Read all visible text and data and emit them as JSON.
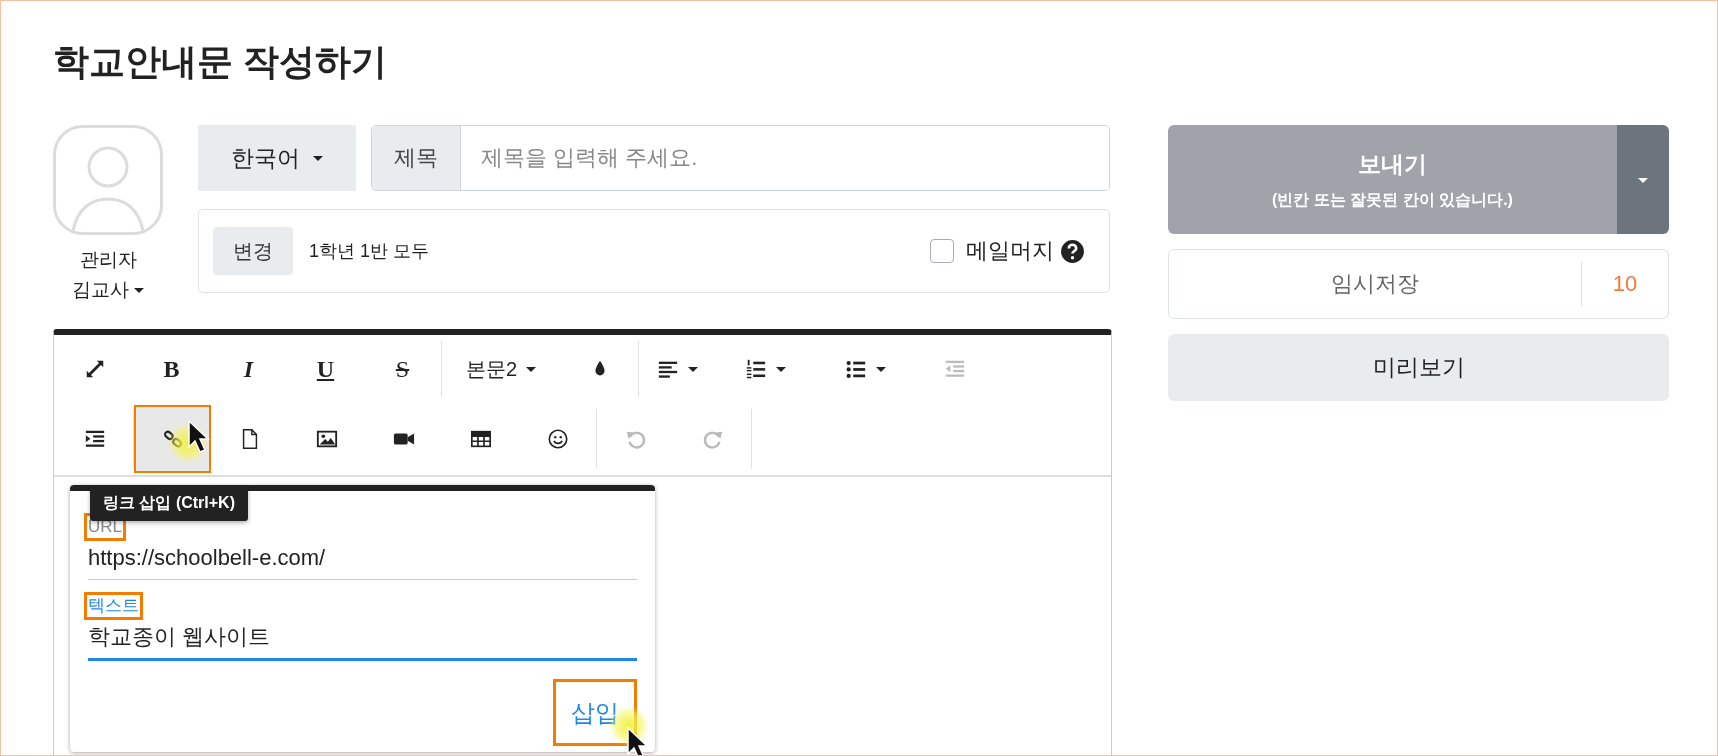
{
  "page_title": "학교안내문 작성하기",
  "author": {
    "role": "관리자",
    "name": "김교사"
  },
  "language": "한국어",
  "subject": {
    "label": "제목",
    "placeholder": "제목을 입력해 주세요."
  },
  "recipients": {
    "button": "변경",
    "value": "1학년 1반 모두",
    "mail_merge": {
      "label": "메일머지",
      "checked": false
    }
  },
  "toolbar": {
    "rows": [
      [
        {
          "kind": "expand",
          "disabled": false,
          "selected": false,
          "annotated": false
        },
        {
          "kind": "bold",
          "label": "B",
          "disabled": false,
          "selected": false,
          "annotated": false
        },
        {
          "kind": "italic",
          "label": "I",
          "disabled": false,
          "selected": false,
          "annotated": false
        },
        {
          "kind": "underline",
          "label": "U",
          "disabled": false,
          "selected": false,
          "annotated": false
        },
        {
          "kind": "strike",
          "label": "S",
          "disabled": false,
          "selected": false,
          "annotated": false
        },
        {
          "kind": "divider"
        },
        {
          "kind": "style-dropdown",
          "label": "본문2",
          "disabled": false,
          "selected": false,
          "annotated": false
        },
        {
          "kind": "color",
          "disabled": false,
          "selected": false,
          "annotated": false
        },
        {
          "kind": "divider"
        },
        {
          "kind": "align",
          "disabled": false,
          "selected": false,
          "annotated": false
        },
        {
          "kind": "ordered-list",
          "disabled": false,
          "selected": false,
          "annotated": false
        },
        {
          "kind": "bullet-list",
          "disabled": false,
          "selected": false,
          "annotated": false
        },
        {
          "kind": "outdent",
          "disabled": true,
          "selected": false,
          "annotated": false
        }
      ],
      [
        {
          "kind": "indent",
          "disabled": false,
          "selected": false,
          "annotated": false
        },
        {
          "kind": "divider"
        },
        {
          "kind": "link",
          "disabled": false,
          "selected": true,
          "annotated": true
        },
        {
          "kind": "file",
          "disabled": false,
          "selected": false,
          "annotated": false
        },
        {
          "kind": "image",
          "disabled": false,
          "selected": false,
          "annotated": false
        },
        {
          "kind": "video",
          "disabled": false,
          "selected": false,
          "annotated": false
        },
        {
          "kind": "table",
          "disabled": false,
          "selected": false,
          "annotated": false
        },
        {
          "kind": "emoji",
          "disabled": false,
          "selected": false,
          "annotated": false
        },
        {
          "kind": "divider"
        },
        {
          "kind": "undo",
          "disabled": true,
          "selected": false,
          "annotated": false
        },
        {
          "kind": "redo",
          "disabled": true,
          "selected": false,
          "annotated": false
        },
        {
          "kind": "divider"
        }
      ]
    ]
  },
  "tooltip": "링크 삽입 (Ctrl+K)",
  "link_dialog": {
    "fields": [
      {
        "label": "URL",
        "value": "https://schoolbell-e.com/",
        "focused": false,
        "annotated": true
      },
      {
        "label": "텍스트",
        "value": "학교종이 웹사이트",
        "focused": true,
        "annotated": true
      }
    ],
    "insert_button": {
      "label": "삽입",
      "annotated": true
    }
  },
  "send": {
    "label": "보내기",
    "note": "(빈칸 또는 잘못된 칸이 있습니다.)",
    "disabled": true
  },
  "temp_save": {
    "label": "임시저장",
    "count": "10"
  },
  "preview": {
    "label": "미리보기"
  }
}
